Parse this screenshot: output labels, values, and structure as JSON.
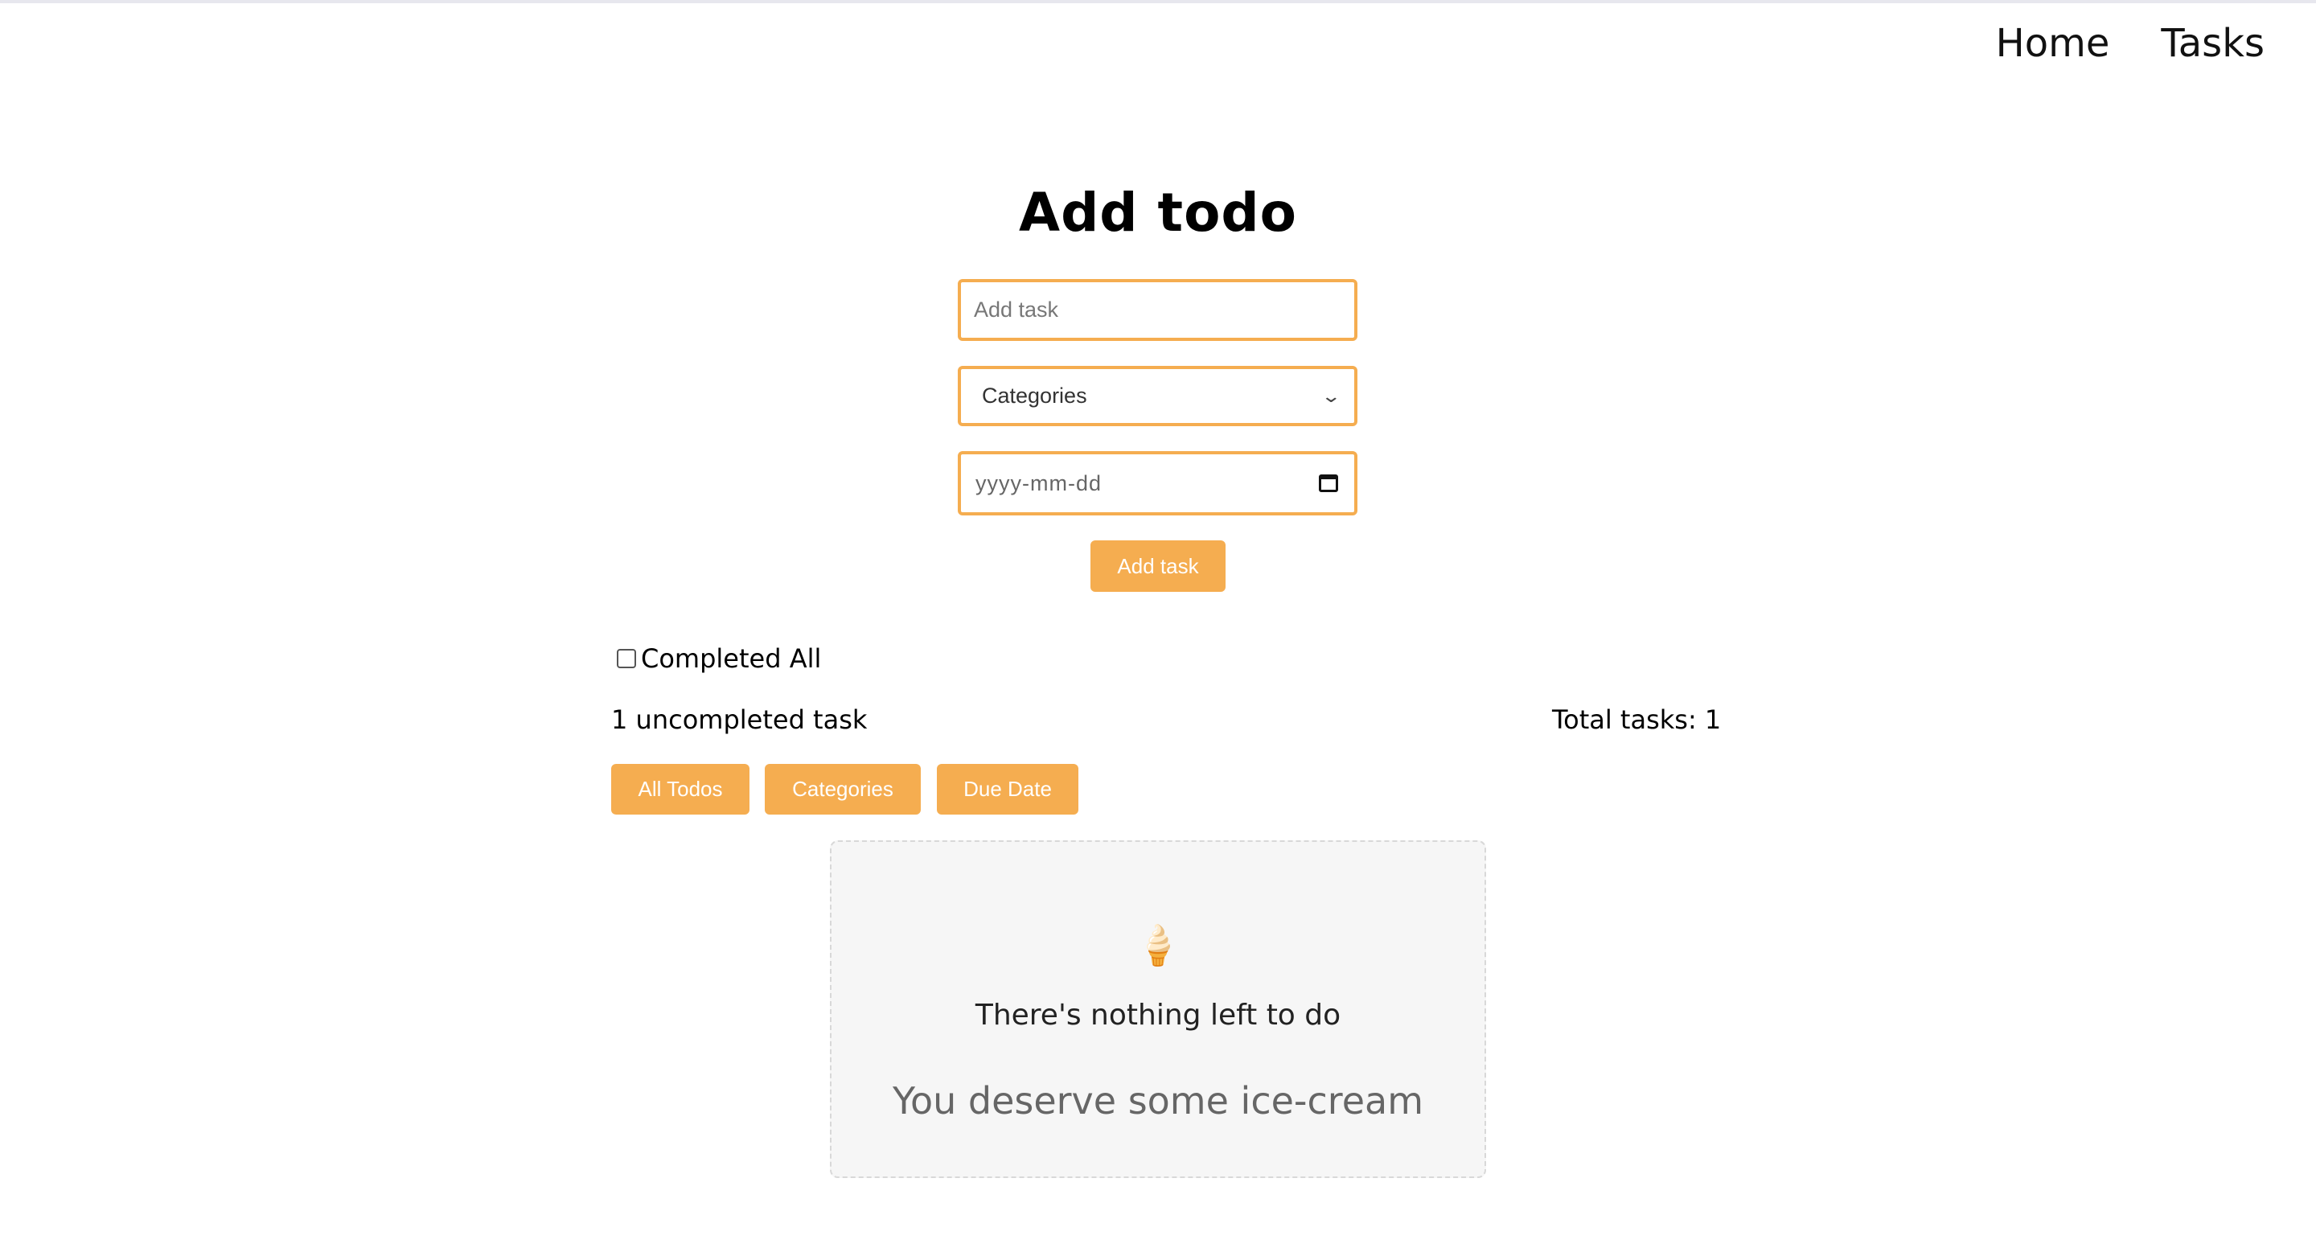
{
  "nav": {
    "home": "Home",
    "tasks": "Tasks"
  },
  "form": {
    "title": "Add todo",
    "task_placeholder": "Add task",
    "category_selected": "Categories",
    "date_placeholder": "yyyy-mm-dd",
    "submit_label": "Add task"
  },
  "controls": {
    "completed_all_label": "Completed All",
    "completed_all_checked": false
  },
  "stats": {
    "uncompleted": "1 uncompleted task",
    "total": "Total tasks: 1"
  },
  "filters": [
    "All Todos",
    "Categories",
    "Due Date"
  ],
  "empty_state": {
    "icon": "🍦",
    "title": "There's nothing left to do",
    "subtitle": "You deserve some ice-cream"
  },
  "colors": {
    "accent": "#f5ad50",
    "card_bg": "#f6f6f6"
  },
  "icons": {
    "select": "chevron-down-icon",
    "date": "calendar-icon"
  }
}
